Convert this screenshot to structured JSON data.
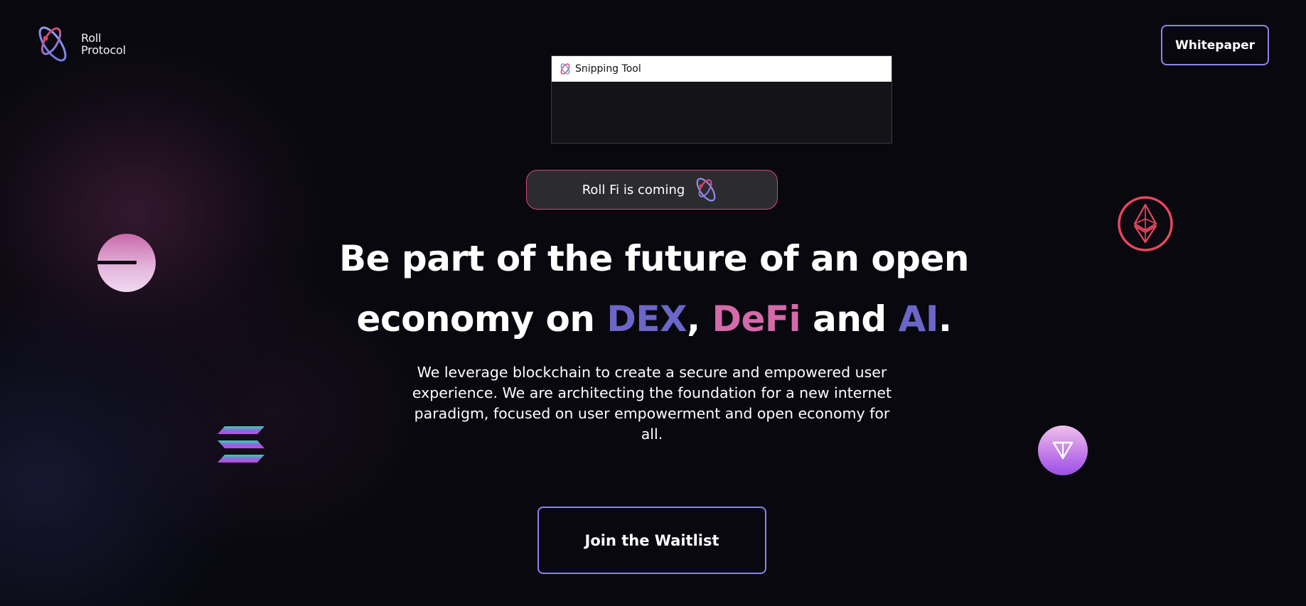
{
  "logo": {
    "line1": "Roll",
    "line2": "Protocol",
    "icon": "roll-protocol-logo-icon"
  },
  "header": {
    "whitepaper_label": "Whitepaper"
  },
  "snipping_tool": {
    "title": "Snipping Tool",
    "icon": "snipping-tool-icon"
  },
  "badge": {
    "text": "Roll Fi is coming",
    "icon": "roll-protocol-logo-icon"
  },
  "hero": {
    "headline_line1": "Be part of the future of an open",
    "headline_prefix": "economy on ",
    "dex": "DEX",
    "comma": ", ",
    "defi": "DeFi",
    "and": " and ",
    "ai": "AI",
    "period": ".",
    "subtitle": "We leverage blockchain to create a secure and empowered user experience. We are architecting the foundation for a new internet paradigm, focused on user empowerment and open economy for all.",
    "cta_label": "Join the Waitlist"
  },
  "coins": {
    "polkadot": "polkadot-coin-icon",
    "ethereum": "ethereum-coin-icon",
    "solana": "solana-coin-icon",
    "ton": "ton-coin-icon"
  },
  "colors": {
    "background": "#08080e",
    "accent_border": "#8b84f0",
    "dex_ai": "#6b66c8",
    "defi": "#d46aa9",
    "badge_border": "#d9437a"
  }
}
